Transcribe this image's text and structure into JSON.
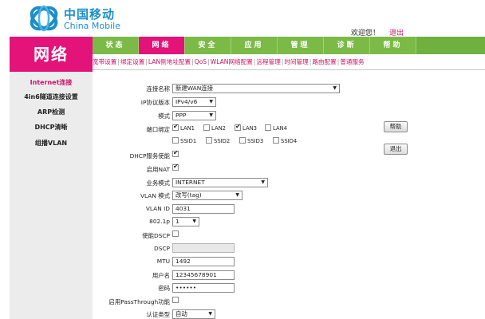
{
  "brand": {
    "name_cn": "中国移动",
    "name_en": "China Mobile",
    "color": "#1a8fc7"
  },
  "header": {
    "welcome": "欢迎您！",
    "logout": "退出"
  },
  "section_label": "网络",
  "tabs": [
    {
      "label": "状态",
      "active": false
    },
    {
      "label": "网络",
      "active": true
    },
    {
      "label": "安全",
      "active": false
    },
    {
      "label": "应用",
      "active": false
    },
    {
      "label": "管理",
      "active": false
    },
    {
      "label": "诊断",
      "active": false
    },
    {
      "label": "帮助",
      "active": false
    }
  ],
  "subnav": [
    "宽带设置",
    "绑定设置",
    "LAN侧地址配置",
    "QoS",
    "WLAN网络配置",
    "远程管理",
    "时间管理",
    "路由配置",
    "普通服务"
  ],
  "sidebar": [
    {
      "label": "Internet连接",
      "active": true
    },
    {
      "label": "4in6隧道连接设置",
      "active": false
    },
    {
      "label": "ARP检测",
      "active": false
    },
    {
      "label": "DHCP清晰",
      "active": false
    },
    {
      "label": "组播VLAN",
      "active": false
    }
  ],
  "form": {
    "conn_name_label": "连接名称",
    "conn_name_value": "新建WAN连接",
    "ip_version_label": "IP协议版本",
    "ip_version_value": "IPv4/v6",
    "mode_label": "模式",
    "mode_value": "PPP",
    "port_bind_label": "端口绑定",
    "ports": [
      {
        "label": "LAN1",
        "checked": true
      },
      {
        "label": "LAN2",
        "checked": false
      },
      {
        "label": "LAN3",
        "checked": true
      },
      {
        "label": "LAN4",
        "checked": false
      },
      {
        "label": "SSID1",
        "checked": false
      },
      {
        "label": "SSID2",
        "checked": false
      },
      {
        "label": "SSID3",
        "checked": false
      },
      {
        "label": "SSID4",
        "checked": false
      }
    ],
    "dhcp_label": "DHCP服务使能",
    "dhcp_checked": true,
    "nat_label": "启用NAT",
    "nat_checked": true,
    "service_mode_label": "业务模式",
    "service_mode_value": "INTERNET",
    "vlan_mode_label": "VLAN 模式",
    "vlan_mode_value": "改写(tag)",
    "vlan_id_label": "VLAN ID",
    "vlan_id_value": "4031",
    "dot1p_label": "802.1p",
    "dot1p_value": "1",
    "dscp_enable_label": "使能DSCP",
    "dscp_enable_checked": false,
    "dscp_label": "DSCP",
    "dscp_value": "",
    "mtu_label": "MTU",
    "mtu_value": "1492",
    "username_label": "用户名",
    "username_value": "12345678901",
    "password_label": "密码",
    "password_value": "••••••",
    "passthrough_label": "启用PassThrough功能",
    "passthrough_checked": false,
    "auth_label": "认证类型",
    "auth_value": "自动"
  },
  "buttons": {
    "help": "帮助",
    "exit": "退出"
  },
  "colors": {
    "accent": "#e3137a",
    "tab_green": "#7cba47",
    "brand_blue": "#1a8fc7",
    "sidebar_bg": "#ececec"
  }
}
